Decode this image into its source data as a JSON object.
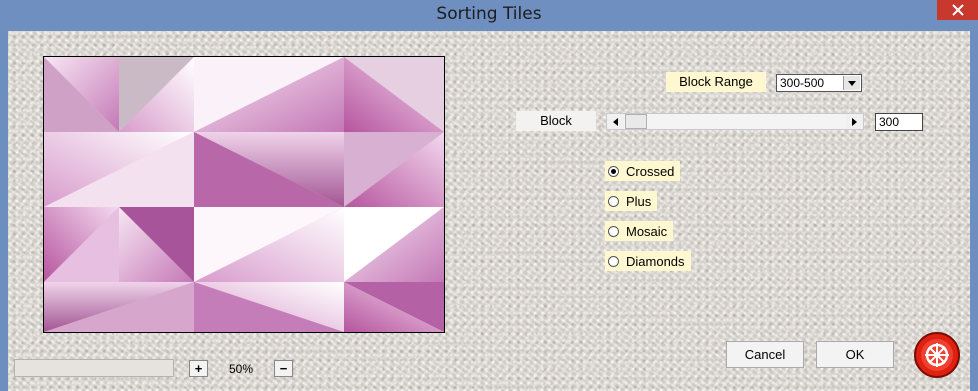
{
  "window": {
    "title": "Sorting Tiles",
    "close_icon": "close-icon"
  },
  "controls": {
    "block_range_label": "Block Range",
    "block_range_value": "300-500",
    "block_label": "Block",
    "block_value": "300",
    "slider_position": 0
  },
  "radios": [
    {
      "label": "Crossed",
      "checked": true
    },
    {
      "label": "Plus",
      "checked": false
    },
    {
      "label": "Mosaic",
      "checked": false
    },
    {
      "label": "Diamonds",
      "checked": false
    }
  ],
  "footer": {
    "zoom_in": "+",
    "zoom_value": "50%",
    "zoom_out": "−",
    "cancel_label": "Cancel",
    "ok_label": "OK"
  },
  "colors": {
    "titlebar": "#6e8fc0",
    "close": "#c8382d",
    "label_bg": "#fff7cf",
    "logo_red": "#e02010"
  }
}
